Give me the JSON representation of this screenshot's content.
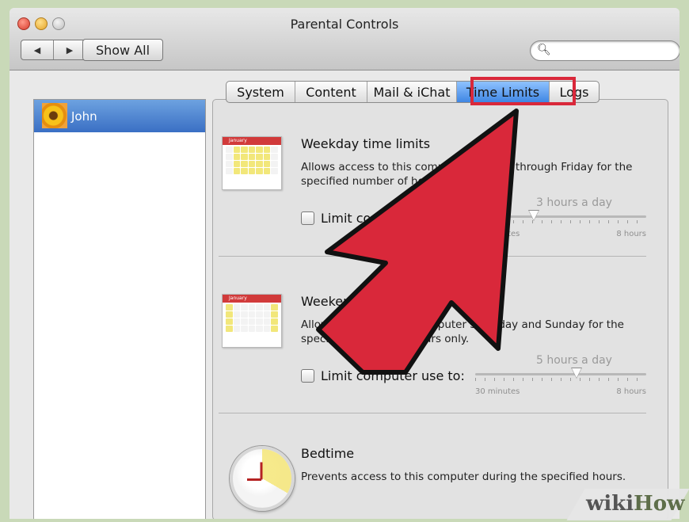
{
  "window": {
    "title": "Parental Controls",
    "toolbar": {
      "back_icon": "◀",
      "forward_icon": "▶",
      "show_all_label": "Show All"
    },
    "search": {
      "placeholder": "",
      "icon": "search-icon"
    }
  },
  "sidebar": {
    "users": [
      {
        "name": "John",
        "selected": true
      }
    ]
  },
  "tabs": [
    {
      "label": "System",
      "selected": false
    },
    {
      "label": "Content",
      "selected": false
    },
    {
      "label": "Mail & iChat",
      "selected": false
    },
    {
      "label": "Time Limits",
      "selected": true
    },
    {
      "label": "Logs",
      "selected": false
    }
  ],
  "sections": {
    "weekday": {
      "title": "Weekday time limits",
      "description": "Allows access to this computer Monday through Friday for the specified number of hours only.",
      "checkbox_label": "Limit computer use to:",
      "checked": false,
      "slider_value": "3 hours a day",
      "slider_min": "30 minutes",
      "slider_max": "8 hours",
      "slider_level": 0.33
    },
    "weekend": {
      "title": "Weekend time limits",
      "description": "Allows access to this computer Saturday and Sunday for the specified number of hours only.",
      "checkbox_label": "Limit computer use to:",
      "checked": false,
      "slider_value": "5 hours a day",
      "slider_min": "30 minutes",
      "slider_max": "8 hours",
      "slider_level": 0.6
    },
    "bedtime": {
      "title": "Bedtime",
      "description": "Prevents access to this computer during the specified hours."
    }
  },
  "watermark": {
    "wiki": "wiki",
    "how": "How"
  },
  "colors": {
    "highlight": "#d9283a",
    "arrow": "#d9283a",
    "selection": "#3a6fc4"
  }
}
